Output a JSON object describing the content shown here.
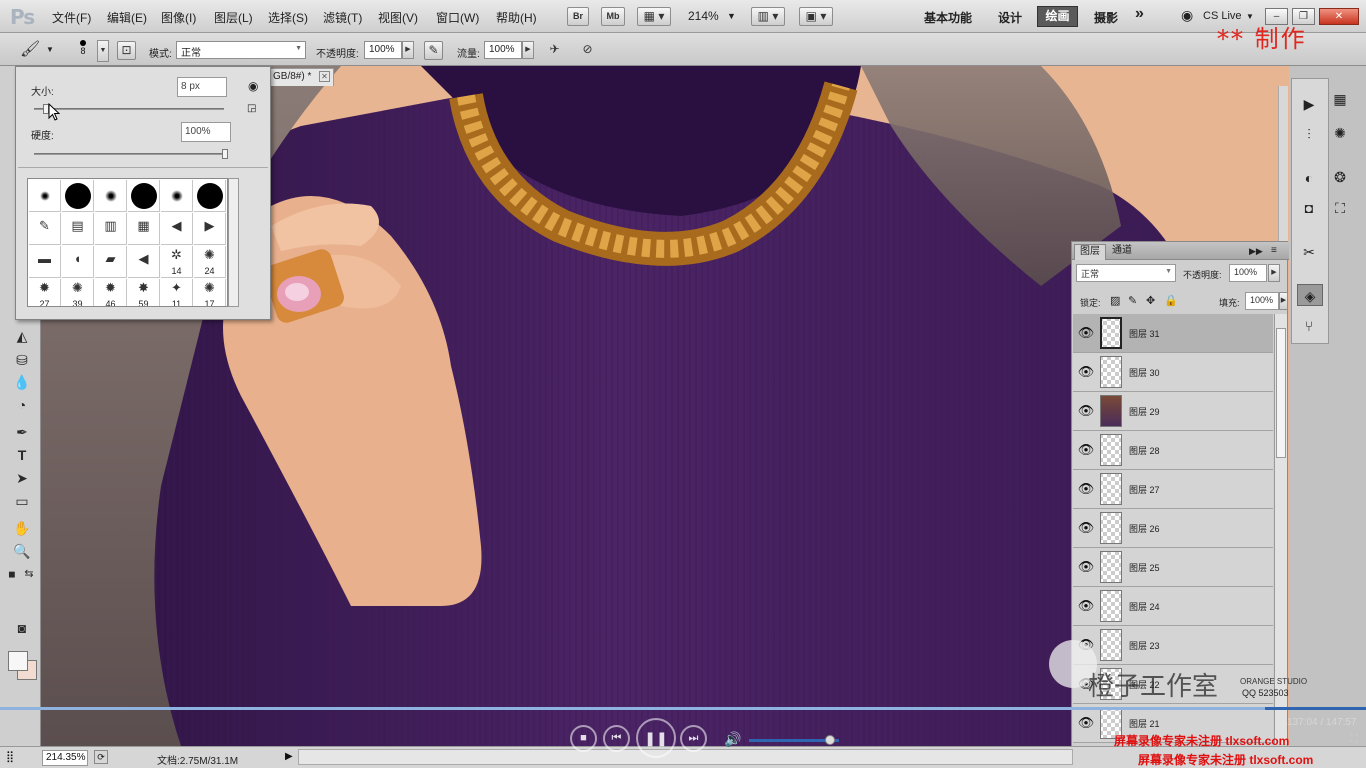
{
  "app": {
    "logo": "Ps"
  },
  "menu": [
    "文件(F)",
    "编辑(E)",
    "图像(I)",
    "图层(L)",
    "选择(S)",
    "滤镜(T)",
    "视图(V)",
    "窗口(W)",
    "帮助(H)"
  ],
  "appbar": {
    "bridge": "Br",
    "mini_bridge": "Mb",
    "zoom": "214%"
  },
  "workspaces": {
    "items": [
      "基本功能",
      "设计",
      "摄影"
    ],
    "active": "绘画",
    "more": "»",
    "cslive": "CS Live"
  },
  "window_controls": {
    "minimize": "–",
    "restore": "❐",
    "close": "✕"
  },
  "options": {
    "brush_size": "8",
    "mode_label": "模式:",
    "mode_value": "正常",
    "opacity_label": "不透明度:",
    "opacity_value": "100%",
    "flow_label": "流量:",
    "flow_value": "100%"
  },
  "watermark_top": "** 制作",
  "document": {
    "tab_title": "GB/8#) *",
    "zoom_status": "214.35%",
    "doc_size": "文档:2.75M/31.1M"
  },
  "brush_panel": {
    "size_label": "大小:",
    "size_value": "8 px",
    "size_level": 0.05,
    "hardness_label": "硬度:",
    "hardness_value": "100%",
    "hardness_level": 1.0,
    "presets": [
      {
        "kind": "soft",
        "d": 10
      },
      {
        "kind": "hard",
        "d": 26
      },
      {
        "kind": "soft",
        "d": 12
      },
      {
        "kind": "hard",
        "d": 26
      },
      {
        "kind": "soft",
        "d": 12
      },
      {
        "kind": "hard",
        "d": 26
      },
      {
        "kind": "glyph",
        "g": "✎"
      },
      {
        "kind": "glyph",
        "g": "▤"
      },
      {
        "kind": "glyph",
        "g": "▥"
      },
      {
        "kind": "glyph",
        "g": "▦"
      },
      {
        "kind": "glyph",
        "g": "◀"
      },
      {
        "kind": "glyph",
        "g": "▶"
      },
      {
        "kind": "glyph",
        "g": "▬"
      },
      {
        "kind": "glyph",
        "g": "◖"
      },
      {
        "kind": "glyph",
        "g": "▰"
      },
      {
        "kind": "glyph",
        "g": "◀"
      },
      {
        "kind": "num",
        "g": "✲",
        "n": "14"
      },
      {
        "kind": "num",
        "g": "✺",
        "n": "24"
      },
      {
        "kind": "num",
        "g": "✹",
        "n": "27"
      },
      {
        "kind": "num",
        "g": "✺",
        "n": "39"
      },
      {
        "kind": "num",
        "g": "✹",
        "n": "46"
      },
      {
        "kind": "num",
        "g": "✸",
        "n": "59"
      },
      {
        "kind": "num",
        "g": "✦",
        "n": "11"
      },
      {
        "kind": "num",
        "g": "✺",
        "n": "17"
      }
    ]
  },
  "layers_panel": {
    "tabs": [
      "图层",
      "通道"
    ],
    "blend_mode": "正常",
    "opacity_label": "不透明度:",
    "opacity_value": "100%",
    "lock_label": "锁定:",
    "fill_label": "填充:",
    "fill_value": "100%",
    "layers": [
      {
        "name": "图层 31",
        "selected": true,
        "photo": false
      },
      {
        "name": "图层 30",
        "selected": false,
        "photo": false
      },
      {
        "name": "图层 29",
        "selected": false,
        "photo": true
      },
      {
        "name": "图层 28",
        "selected": false,
        "photo": false
      },
      {
        "name": "图层 27",
        "selected": false,
        "photo": false
      },
      {
        "name": "图层 26",
        "selected": false,
        "photo": false
      },
      {
        "name": "图层 25",
        "selected": false,
        "photo": false
      },
      {
        "name": "图层 24",
        "selected": false,
        "photo": false
      },
      {
        "name": "图层 23",
        "selected": false,
        "photo": false
      },
      {
        "name": "图层 22",
        "selected": false,
        "photo": false
      },
      {
        "name": "图层 21",
        "selected": false,
        "photo": false
      }
    ]
  },
  "player": {
    "time": "137:04 / 147:57",
    "progress": 0.926,
    "volume": 0.9
  },
  "watermarks": {
    "studio": "橙子工作室",
    "studio_en": "ORANGE STUDIO",
    "qq": "QQ 523503",
    "rec1": "屏幕录像专家未注册 tlxsoft.com",
    "rec2": "屏幕录像专家未注册 tlxsoft.com"
  },
  "colors": {
    "sweater": "#45205e",
    "skin": "#e8b593",
    "accent_blue": "#2e64b0",
    "watermark_red": "#e0261d"
  }
}
